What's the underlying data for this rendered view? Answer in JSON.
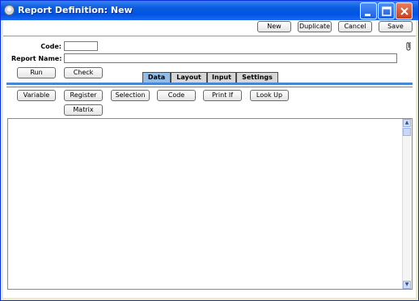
{
  "window": {
    "title": "Report Definition: New"
  },
  "toolbar": {
    "new": "New",
    "duplicate": "Duplicate",
    "cancel": "Cancel",
    "save": "Save"
  },
  "form": {
    "code_label": "Code:",
    "code_value": "",
    "report_name_label": "Report Name:",
    "report_name_value": ""
  },
  "actions": {
    "run": "Run",
    "check": "Check"
  },
  "tabs": [
    {
      "label": "Data",
      "active": true
    },
    {
      "label": "Layout",
      "active": false
    },
    {
      "label": "Input",
      "active": false
    },
    {
      "label": "Settings",
      "active": false
    }
  ],
  "data_buttons": {
    "variable": "Variable",
    "register": "Register",
    "selection": "Selection",
    "code": "Code",
    "print_if": "Print If",
    "look_up": "Look Up",
    "matrix": "Matrix"
  },
  "icons": {
    "attachment": "paperclip-icon",
    "minimize": "minimize-icon",
    "maximize": "maximize-icon",
    "close": "close-icon"
  }
}
